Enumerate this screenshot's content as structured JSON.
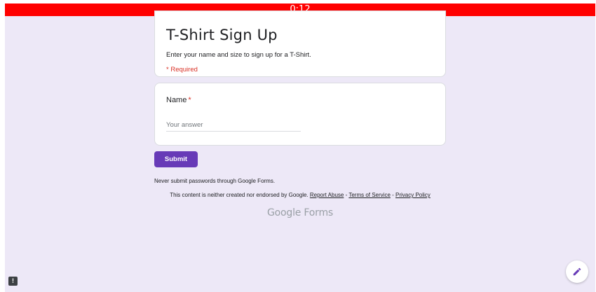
{
  "timer": {
    "text": "0:12",
    "color": "#ff0000"
  },
  "form": {
    "title": "T-Shirt Sign Up",
    "description": "Enter your name and size to sign up for a T-Shirt.",
    "required_note": "* Required"
  },
  "question": {
    "label": "Name",
    "asterisk": "*",
    "placeholder": "Your answer"
  },
  "submit": {
    "label": "Submit",
    "color": "#673ab7"
  },
  "footer": {
    "password_warning": "Never submit passwords through Google Forms.",
    "disclaimer": "This content is neither created nor endorsed by Google.",
    "report_abuse": "Report Abuse",
    "sep1": " - ",
    "terms": "Terms of Service",
    "sep2": " - ",
    "privacy": "Privacy Policy",
    "brand": "Google Forms"
  },
  "icons": {
    "report": "report-icon",
    "edit": "pencil-icon"
  }
}
